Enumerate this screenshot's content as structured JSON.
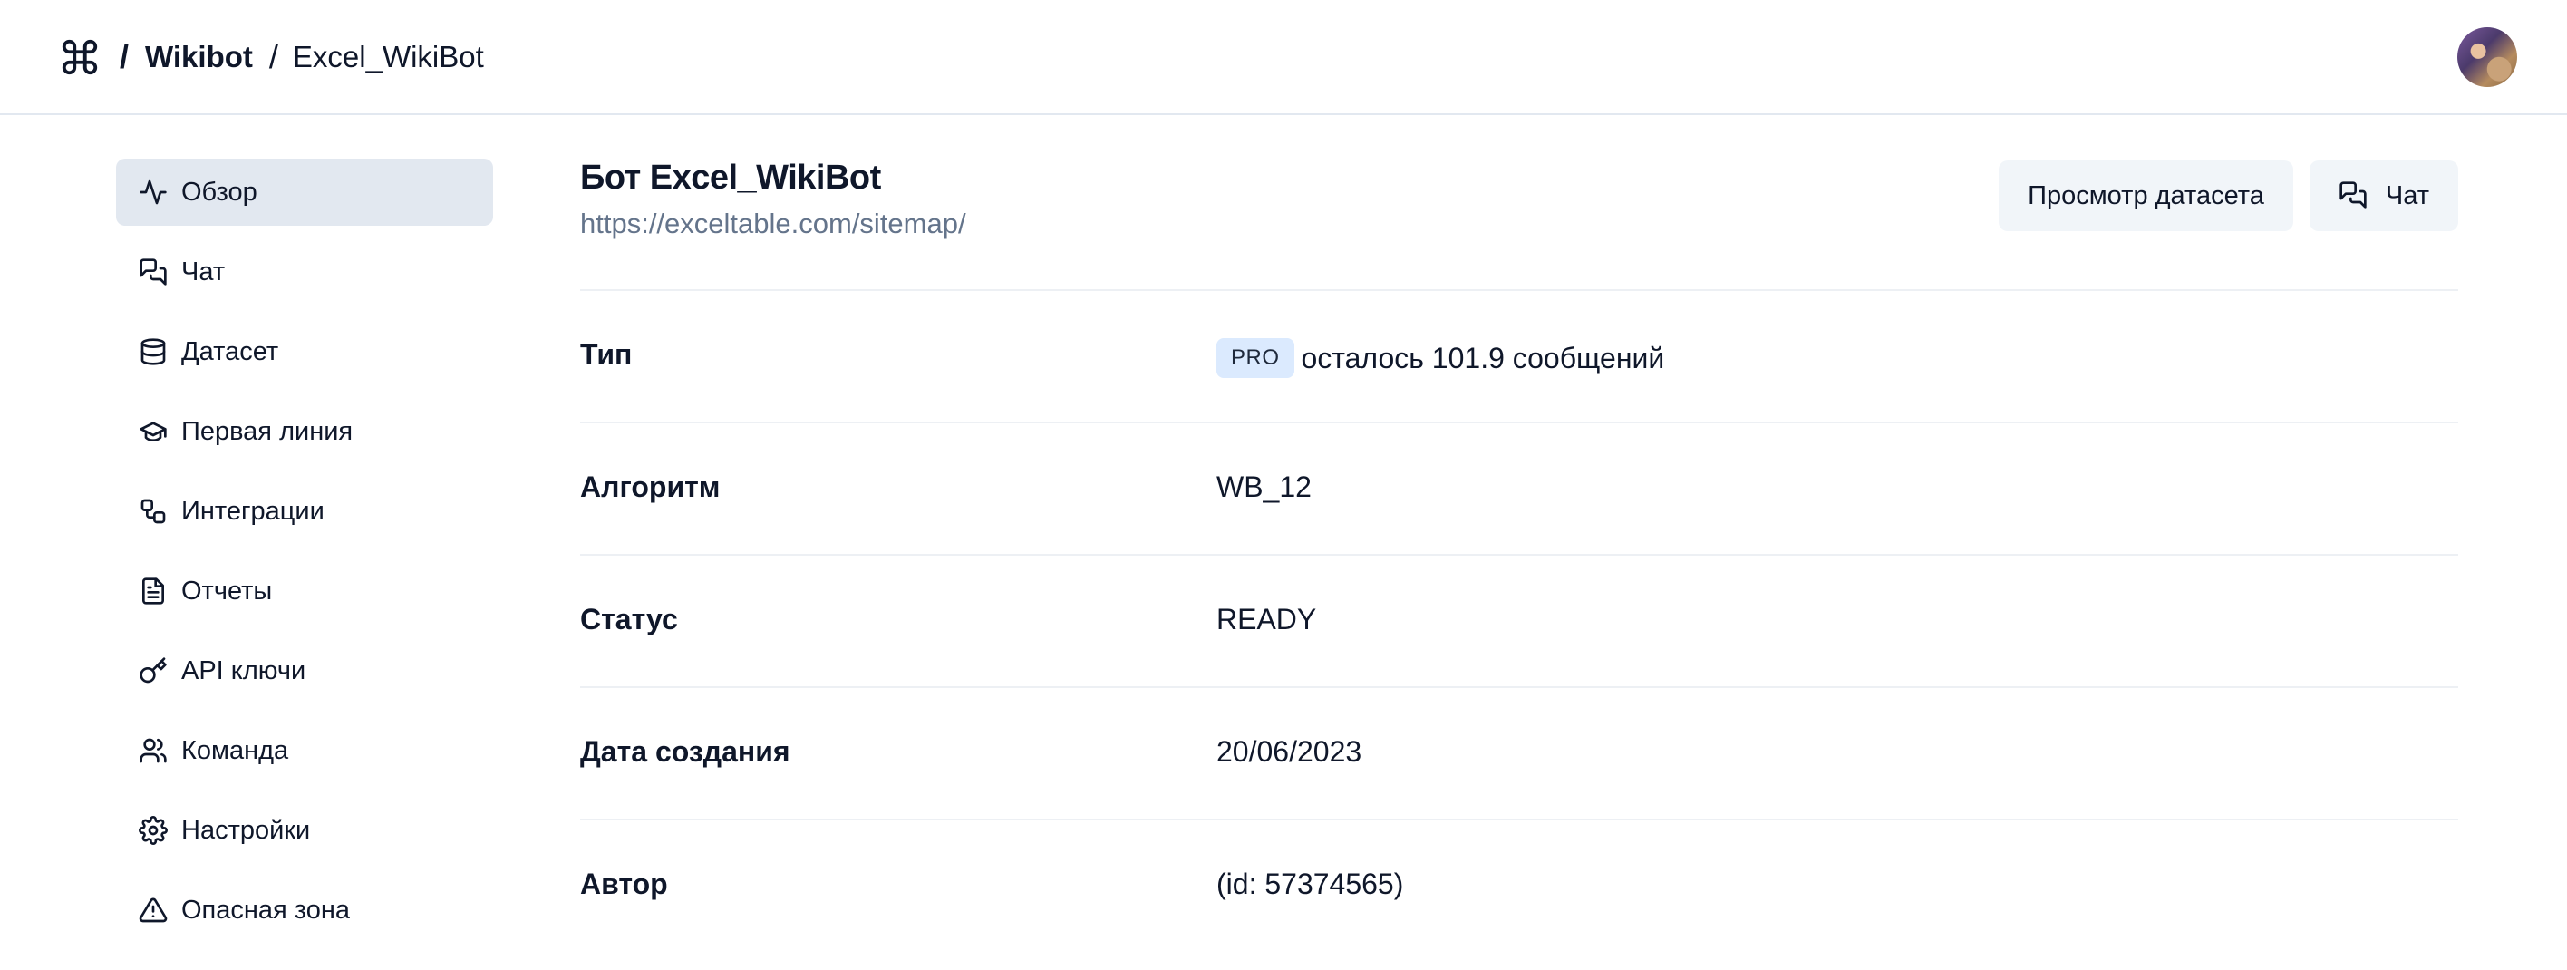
{
  "header": {
    "logo_icon": "command-icon",
    "breadcrumb": {
      "separator": "/",
      "workspace": "Wikibot",
      "bot": "Excel_WikiBot"
    },
    "avatar_icon": "user-avatar"
  },
  "sidebar": {
    "items": [
      {
        "label": "Обзор",
        "icon": "activity-icon",
        "active": true
      },
      {
        "label": "Чат",
        "icon": "chat-icon"
      },
      {
        "label": "Датасет",
        "icon": "database-icon"
      },
      {
        "label": "Первая линия",
        "icon": "graduation-cap-icon"
      },
      {
        "label": "Интеграции",
        "icon": "workflow-icon"
      },
      {
        "label": "Отчеты",
        "icon": "file-text-icon"
      },
      {
        "label": "API ключи",
        "icon": "key-icon"
      },
      {
        "label": "Команда",
        "icon": "users-icon"
      },
      {
        "label": "Настройки",
        "icon": "gear-icon"
      },
      {
        "label": "Опасная зона",
        "icon": "warning-icon"
      }
    ]
  },
  "main": {
    "title": "Бот Excel_WikiBot",
    "url": "https://exceltable.com/sitemap/",
    "actions": {
      "dataset_button": "Просмотр датасета",
      "chat_button": "Чат"
    },
    "rows": [
      {
        "label": "Тип",
        "badge": "PRO",
        "value": "осталось 101.9 сообщений"
      },
      {
        "label": "Алгоритм",
        "value": "WB_12"
      },
      {
        "label": "Статус",
        "value": "READY"
      },
      {
        "label": "Дата создания",
        "value": "20/06/2023"
      },
      {
        "label": "Автор",
        "value": "(id: 57374565)"
      }
    ]
  },
  "colors": {
    "active_nav_bg": "#e2e8f0",
    "button_bg": "#f1f5f9",
    "badge_bg": "#dbeafe",
    "muted_text": "#64748b",
    "text": "#0f172a"
  }
}
